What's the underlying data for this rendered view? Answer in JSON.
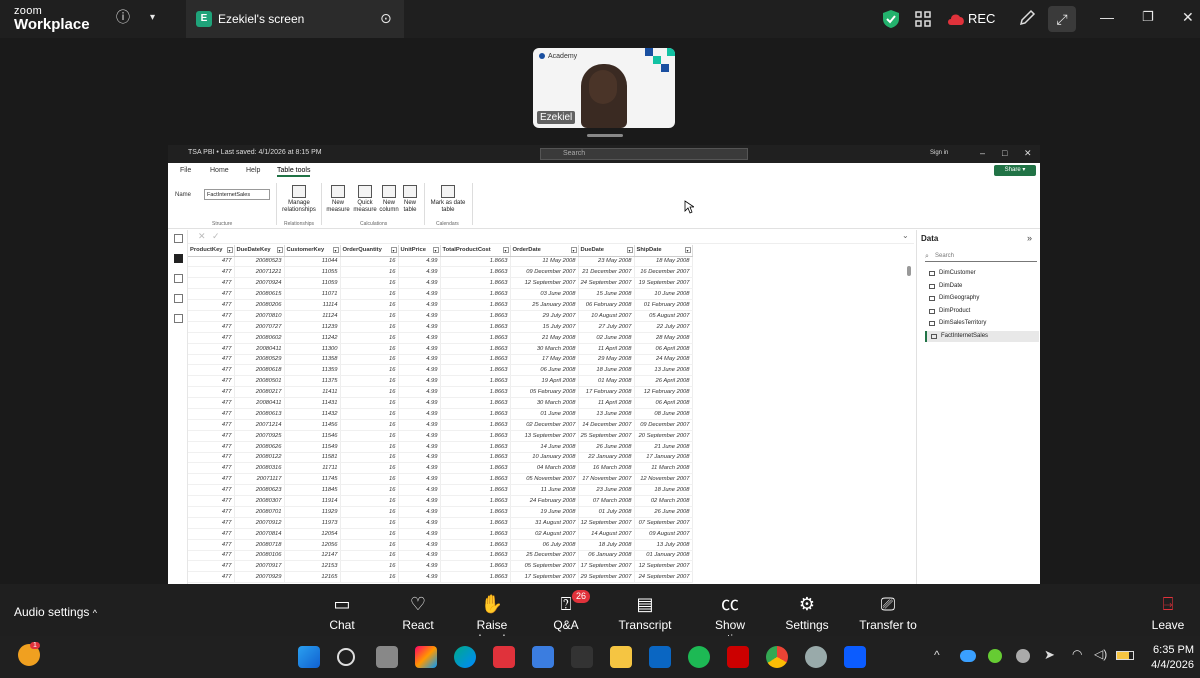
{
  "zoom": {
    "logo_line1": "zoom",
    "logo_line2": "Workplace",
    "share_tab_badge": "E",
    "share_tab_title": "Ezekiel's screen",
    "rec_label": "REC",
    "video_name": "Ezekiel",
    "video_brand": "Academy",
    "audio_settings": "Audio settings",
    "toolbar": [
      {
        "label": "Chat",
        "icon": "chat-icon"
      },
      {
        "label": "React",
        "icon": "heart-icon"
      },
      {
        "label": "Raise hand",
        "icon": "hand-icon"
      },
      {
        "label": "Q&A",
        "icon": "qa-icon",
        "badge": "26"
      },
      {
        "label": "Transcript",
        "icon": "transcript-icon"
      },
      {
        "label": "Show captions",
        "icon": "cc-icon"
      },
      {
        "label": "Settings",
        "icon": "gear-icon"
      },
      {
        "label": "Transfer to room",
        "icon": "transfer-icon"
      }
    ],
    "leave": "Leave"
  },
  "pbi": {
    "title": "TSA PBI • Last saved: 4/1/2026 at 8:15 PM",
    "search_placeholder": "Search",
    "sign_in": "Sign in",
    "tabs": [
      "File",
      "Home",
      "Help",
      "Table tools"
    ],
    "share": "Share",
    "ribbon": {
      "name_label": "Name",
      "name_value": "FactInternetSales",
      "structure_label": "Structure",
      "manage_relationships": "Manage relationships",
      "relationships_label": "Relationships",
      "new_measure": "New measure",
      "quick_measure": "Quick measure",
      "new_column": "New column",
      "new_table": "New table",
      "calculations_label": "Calculations",
      "mark_as_date_table": "Mark as date table",
      "calendars_label": "Calendars"
    },
    "columns": [
      "ProductKey",
      "DueDateKey",
      "CustomerKey",
      "OrderQuantity",
      "UnitPrice",
      "TotalProductCost",
      "OrderDate",
      "DueDate",
      "ShipDate"
    ],
    "rows": [
      [
        "477",
        "20080523",
        "11044",
        "16",
        "4.99",
        "1.8663",
        "11 May 2008",
        "23 May 2008",
        "18 May 2008"
      ],
      [
        "477",
        "20071221",
        "11055",
        "16",
        "4.99",
        "1.8663",
        "09 December 2007",
        "21 December 2007",
        "16 December 2007"
      ],
      [
        "477",
        "20070924",
        "11059",
        "16",
        "4.99",
        "1.8663",
        "12 September 2007",
        "24 September 2007",
        "19 September 2007"
      ],
      [
        "477",
        "20080615",
        "11071",
        "16",
        "4.99",
        "1.8663",
        "03 June 2008",
        "15 June 2008",
        "10 June 2008"
      ],
      [
        "477",
        "20080206",
        "11114",
        "16",
        "4.99",
        "1.8663",
        "25 January 2008",
        "06 February 2008",
        "01 February 2008"
      ],
      [
        "477",
        "20070810",
        "11124",
        "16",
        "4.99",
        "1.8663",
        "29 July 2007",
        "10 August 2007",
        "05 August 2007"
      ],
      [
        "477",
        "20070727",
        "11239",
        "16",
        "4.99",
        "1.8663",
        "15 July 2007",
        "27 July 2007",
        "22 July 2007"
      ],
      [
        "477",
        "20080602",
        "11242",
        "16",
        "4.99",
        "1.8663",
        "21 May 2008",
        "02 June 2008",
        "28 May 2008"
      ],
      [
        "477",
        "20080411",
        "11300",
        "16",
        "4.99",
        "1.8663",
        "30 March 2008",
        "11 April 2008",
        "06 April 2008"
      ],
      [
        "477",
        "20080529",
        "11358",
        "16",
        "4.99",
        "1.8663",
        "17 May 2008",
        "29 May 2008",
        "24 May 2008"
      ],
      [
        "477",
        "20080618",
        "11359",
        "16",
        "4.99",
        "1.8663",
        "06 June 2008",
        "18 June 2008",
        "13 June 2008"
      ],
      [
        "477",
        "20080501",
        "11375",
        "16",
        "4.99",
        "1.8663",
        "19 April 2008",
        "01 May 2008",
        "26 April 2008"
      ],
      [
        "477",
        "20080217",
        "11411",
        "16",
        "4.99",
        "1.8663",
        "05 February 2008",
        "17 February 2008",
        "12 February 2008"
      ],
      [
        "477",
        "20080411",
        "11431",
        "16",
        "4.99",
        "1.8663",
        "30 March 2008",
        "11 April 2008",
        "06 April 2008"
      ],
      [
        "477",
        "20080613",
        "11432",
        "16",
        "4.99",
        "1.8663",
        "01 June 2008",
        "13 June 2008",
        "08 June 2008"
      ],
      [
        "477",
        "20071214",
        "11456",
        "16",
        "4.99",
        "1.8663",
        "02 December 2007",
        "14 December 2007",
        "09 December 2007"
      ],
      [
        "477",
        "20070925",
        "11546",
        "16",
        "4.99",
        "1.8663",
        "13 September 2007",
        "25 September 2007",
        "20 September 2007"
      ],
      [
        "477",
        "20080626",
        "11549",
        "16",
        "4.99",
        "1.8663",
        "14 June 2008",
        "26 June 2008",
        "21 June 2008"
      ],
      [
        "477",
        "20080122",
        "11581",
        "16",
        "4.99",
        "1.8663",
        "10 January 2008",
        "22 January 2008",
        "17 January 2008"
      ],
      [
        "477",
        "20080316",
        "11711",
        "16",
        "4.99",
        "1.8663",
        "04 March 2008",
        "16 March 2008",
        "11 March 2008"
      ],
      [
        "477",
        "20071117",
        "11745",
        "16",
        "4.99",
        "1.8663",
        "05 November 2007",
        "17 November 2007",
        "12 November 2007"
      ],
      [
        "477",
        "20080623",
        "11845",
        "16",
        "4.99",
        "1.8663",
        "11 June 2008",
        "23 June 2008",
        "18 June 2008"
      ],
      [
        "477",
        "20080307",
        "11914",
        "16",
        "4.99",
        "1.8663",
        "24 February 2008",
        "07 March 2008",
        "02 March 2008"
      ],
      [
        "477",
        "20080701",
        "11929",
        "16",
        "4.99",
        "1.8663",
        "19 June 2008",
        "01 July 2008",
        "26 June 2008"
      ],
      [
        "477",
        "20070912",
        "11973",
        "16",
        "4.99",
        "1.8663",
        "31 August 2007",
        "12 September 2007",
        "07 September 2007"
      ],
      [
        "477",
        "20070814",
        "12054",
        "16",
        "4.99",
        "1.8663",
        "02 August 2007",
        "14 August 2007",
        "09 August 2007"
      ],
      [
        "477",
        "20080718",
        "12056",
        "16",
        "4.99",
        "1.8663",
        "06 July 2008",
        "18 July 2008",
        "13 July 2008"
      ],
      [
        "477",
        "20080106",
        "12147",
        "16",
        "4.99",
        "1.8663",
        "25 December 2007",
        "06 January 2008",
        "01 January 2008"
      ],
      [
        "477",
        "20070917",
        "12153",
        "16",
        "4.99",
        "1.8663",
        "05 September 2007",
        "17 September 2007",
        "12 September 2007"
      ],
      [
        "477",
        "20070929",
        "12165",
        "16",
        "4.99",
        "1.8663",
        "17 September 2007",
        "29 September 2007",
        "24 September 2007"
      ]
    ],
    "data_pane": {
      "title": "Data",
      "search_placeholder": "Search",
      "tables": [
        "DimCustomer",
        "DimDate",
        "DimGeography",
        "DimProduct",
        "DimSalesTerritory",
        "FactInternetSales"
      ],
      "selected": "FactInternetSales"
    }
  },
  "taskbar": {
    "time": "6:35 PM",
    "date": "4/4/2026",
    "notification_count": "1"
  },
  "colors": {
    "powerbi_green": "#217346",
    "zoom_dark": "#1f1f1f",
    "badge_red": "#e0323b",
    "zoom_blue": "#0b5cff"
  }
}
